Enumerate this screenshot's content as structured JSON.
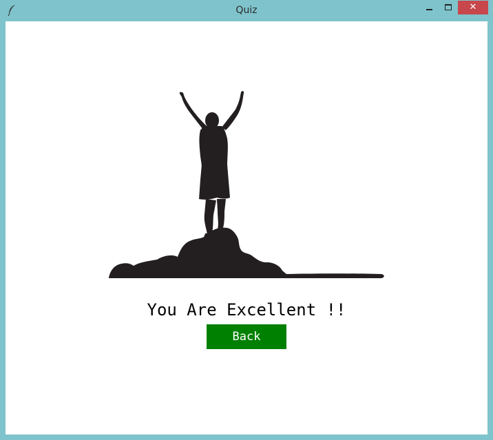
{
  "window": {
    "title": "Quiz",
    "close_glyph": "✕",
    "app_icon": "feather-icon"
  },
  "content": {
    "message": "You Are Excellent !!",
    "back_label": "Back",
    "illustration": "person-celebrating-on-mountain-silhouette"
  },
  "colors": {
    "titlebar": "#7fc4cc",
    "close_button": "#c7474d",
    "back_button": "#008000",
    "background": "#ffffff",
    "silhouette": "#231f20"
  }
}
